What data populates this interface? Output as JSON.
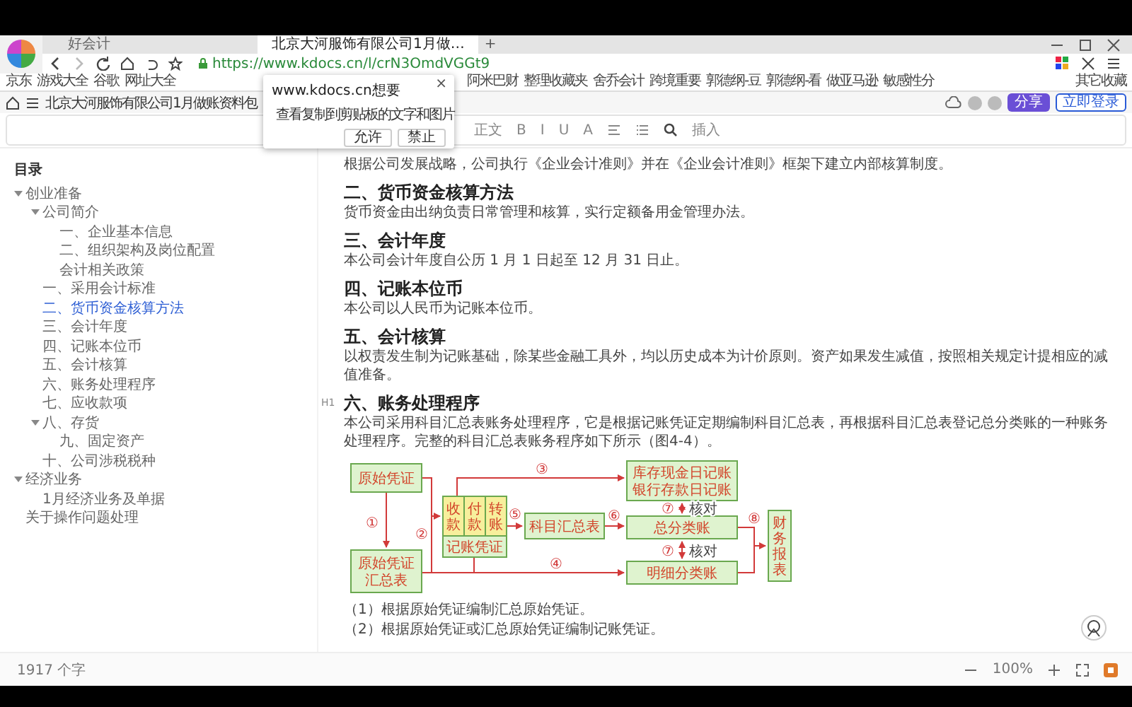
{
  "browser": {
    "tabs": [
      {
        "label": "好会计",
        "selected": false
      },
      {
        "label": "北京大河服饰有限公司1月做…",
        "selected": true
      }
    ],
    "new_tab": "+",
    "address": "https://www.kdocs.cn/l/crN3OmdVGGt9",
    "bookmarks_left": [
      "京东",
      "游戏大全",
      "谷歌",
      "网址大全"
    ],
    "bookmarks_right": [
      "阿米巴财",
      "整理收藏夹",
      "舍乔会计",
      "跨境重要",
      "郭德纲-豆",
      "郭德纲-看",
      "做亚马逊",
      "敏感性分"
    ],
    "other_bookmarks": "其它收藏"
  },
  "permission_dialog": {
    "title": "www.kdocs.cn想要",
    "close": "×",
    "permission": "查看复制到剪贴板的文字和图片",
    "buttons": [
      "允许",
      "禁止"
    ]
  },
  "doc_header": {
    "title": "北京大河服饰有限公司1月做账资料包",
    "share": "分享",
    "login": "立即登录"
  },
  "toolbar": {
    "style": "正文",
    "format": [
      "B",
      "I",
      "U",
      "A"
    ],
    "insert": "插入"
  },
  "outline": {
    "title": "目录",
    "items": [
      {
        "label": "创业准备",
        "selected": false,
        "expanded": true,
        "children": [
          {
            "label": "公司简介",
            "selected": false,
            "expanded": true,
            "children": [
              {
                "label": "一、企业基本信息",
                "selected": false
              },
              {
                "label": "二、组织架构及岗位配置",
                "selected": false
              },
              {
                "label": "会计相关政策",
                "selected": false
              }
            ]
          },
          {
            "label": "一、采用会计标准",
            "selected": false
          },
          {
            "label": "二、货币资金核算方法",
            "selected": true
          },
          {
            "label": "三、会计年度",
            "selected": false
          },
          {
            "label": "四、记账本位币",
            "selected": false
          },
          {
            "label": "五、会计核算",
            "selected": false
          },
          {
            "label": "六、账务处理程序",
            "selected": false
          },
          {
            "label": "七、应收款项",
            "selected": false
          },
          {
            "label": "八、存货",
            "selected": false,
            "expanded": true,
            "children": [
              {
                "label": "九、固定资产",
                "selected": false
              }
            ]
          },
          {
            "label": "十、公司涉税税种",
            "selected": false
          }
        ]
      },
      {
        "label": "经济业务",
        "selected": false,
        "expanded": true,
        "children": [
          {
            "label": "1月经济业务及单据",
            "selected": false
          }
        ]
      },
      {
        "label": "关于操作问题处理",
        "selected": false
      }
    ],
    "word_count": "1917 个字"
  },
  "document": {
    "blocks": [
      {
        "kind": "paragraph",
        "text": "根据公司发展战略，公司执行《企业会计准则》并在《企业会计准则》框架下建立内部核算制度。"
      },
      {
        "kind": "heading",
        "text": "二、货币资金核算方法"
      },
      {
        "kind": "paragraph",
        "text": "货币资金由出纳负责日常管理和核算，实行定额备用金管理办法。"
      },
      {
        "kind": "heading",
        "text": "三、会计年度"
      },
      {
        "kind": "paragraph",
        "text": "本公司会计年度自公历 1 月 1 日起至 12 月 31 日止。"
      },
      {
        "kind": "heading",
        "text": "四、记账本位币"
      },
      {
        "kind": "paragraph",
        "text": "本公司以人民币为记账本位币。"
      },
      {
        "kind": "heading",
        "text": "五、会计核算"
      },
      {
        "kind": "paragraph",
        "text": "以权责发生制为记账基础，除某些金融工具外，均以历史成本为计价原则。资产如果发生减值，按照相关规定计提相应的减值准备。"
      },
      {
        "kind": "heading",
        "text": "六、账务处理程序",
        "handle": "H1"
      },
      {
        "kind": "paragraph",
        "text": "本公司采用科目汇总表账务处理程序，它是根据记账凭证定期编制科目汇总表，再根据科目汇总表登记总分类账的一种账务处理程序。完整的科目汇总表账务程序如下所示（图4-4）。"
      },
      {
        "kind": "diagram"
      },
      {
        "kind": "list_item",
        "text": "（1）根据原始凭证编制汇总原始凭证。"
      },
      {
        "kind": "list_item",
        "text": "（2）根据原始凭证或汇总原始凭证编制记账凭证。"
      }
    ]
  },
  "diagram": {
    "nodes": [
      {
        "kind": "box",
        "lines": [
          "原始凭证"
        ]
      },
      {
        "kind": "box",
        "lines": [
          "原始凭证",
          "汇总表"
        ]
      },
      {
        "kind": "voucher",
        "text": "收款"
      },
      {
        "kind": "voucher",
        "text": "付款"
      },
      {
        "kind": "voucher",
        "text": "转账"
      },
      {
        "kind": "box",
        "lines": [
          "记账凭证"
        ]
      },
      {
        "kind": "box",
        "lines": [
          "科目汇总表"
        ]
      },
      {
        "kind": "box",
        "lines": [
          "库存现金日记账",
          "银行存款日记账"
        ]
      },
      {
        "kind": "box",
        "lines": [
          "总分类账"
        ]
      },
      {
        "kind": "box",
        "lines": [
          "明细分类账"
        ]
      },
      {
        "kind": "column",
        "text": "财务报表"
      }
    ],
    "labels": [
      {
        "kind": "step",
        "text": "③"
      },
      {
        "kind": "step",
        "text": "①"
      },
      {
        "kind": "step",
        "text": "②"
      },
      {
        "kind": "step",
        "text": "⑤"
      },
      {
        "kind": "step",
        "text": "⑥"
      },
      {
        "kind": "step",
        "text": "④"
      },
      {
        "kind": "step",
        "text": "⑦"
      },
      {
        "kind": "check",
        "text": "核对"
      },
      {
        "kind": "step",
        "text": "⑦"
      },
      {
        "kind": "check",
        "text": "核对"
      },
      {
        "kind": "step",
        "text": "⑧"
      }
    ]
  },
  "zoom": {
    "value": "100%"
  }
}
